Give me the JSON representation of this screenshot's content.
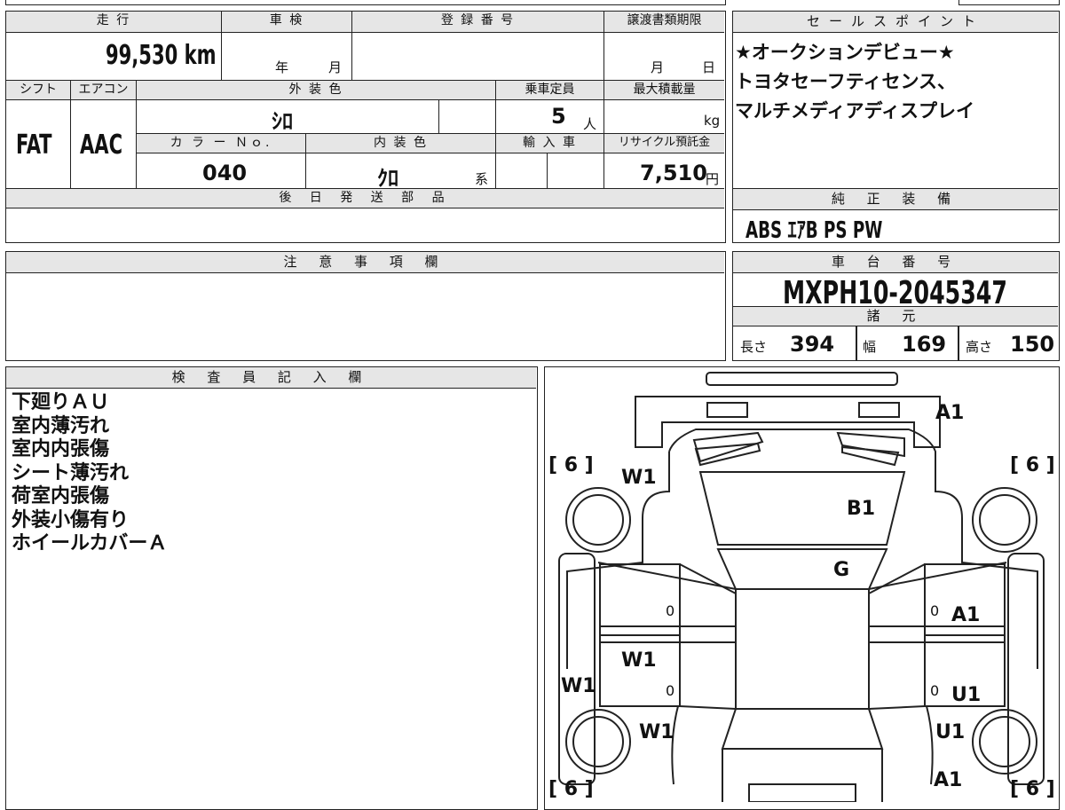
{
  "mileage": {
    "label": "走 行",
    "value": "99,530",
    "unit": "km"
  },
  "shaken": {
    "label": "車 検",
    "year_label": "年",
    "month_label": "月"
  },
  "registration": {
    "label": "登 録 番 号",
    "value": ""
  },
  "transfer_deadline": {
    "label": "譲渡書類期限",
    "month_label": "月",
    "day_label": "日"
  },
  "shift": {
    "label": "シフト",
    "value": "FAT"
  },
  "aircon": {
    "label": "エアコン",
    "value": "AAC"
  },
  "exterior_color": {
    "label": "外 装 色",
    "value": "ｼﾛ"
  },
  "capacity": {
    "label": "乗車定員",
    "value": "5",
    "unit": "人"
  },
  "max_load": {
    "label": "最大積載量",
    "unit": "kg"
  },
  "color_no": {
    "label": "カ ラ ー Ｎｏ.",
    "value": "040"
  },
  "interior_color": {
    "label": "内 装 色",
    "value": "ｸﾛ",
    "suffix": "系"
  },
  "import": {
    "label": "輸 入 車"
  },
  "recycle": {
    "label": "リサイクル預託金",
    "value": "7,510",
    "unit": "円"
  },
  "later_parts": {
    "label": "後 日 発 送 部 品"
  },
  "sales_point": {
    "label": "セールスポイント",
    "lines": [
      "★オークションデビュー★",
      "トヨタセーフティセンス、",
      "マルチメディアディスプレイ"
    ]
  },
  "genuine_equipment": {
    "label": "純 正 装 備",
    "value": "ABS ｴｱB PS PW"
  },
  "caution": {
    "label": "注 意 事 項 欄"
  },
  "chassis_number": {
    "label": "車 台 番 号",
    "value": "MXPH10-2045347"
  },
  "specs": {
    "label": "諸 元",
    "length_label": "長さ",
    "length": "394",
    "width_label": "幅",
    "width": "169",
    "height_label": "高さ",
    "height": "150"
  },
  "inspector_notes": {
    "label": "検 査 員 記 入 欄",
    "lines": [
      "下廻りＡＵ",
      "室内薄汚れ",
      "室内内張傷",
      "シート薄汚れ",
      "荷室内張傷",
      "外装小傷有り",
      "ホイールカバーＡ"
    ]
  },
  "damage_map": {
    "tire_tl": "[ 6 ]",
    "tire_tr": "[ 6 ]",
    "tire_bl": "[ 6 ]",
    "tire_br": "[ 6 ]",
    "front_bumper": "A1",
    "windshield": "B1",
    "hood": "G",
    "left_front_fender": "W1",
    "left_door_rear": "W1",
    "left_sill": "W1",
    "left_rear_fender": "W1",
    "right_front_door": "A1",
    "right_rear_door": "U1",
    "right_rear_fender": "U1",
    "rear_right": "A1",
    "zero_a": "0",
    "zero_b": "0",
    "zero_c": "0",
    "zero_d": "0"
  }
}
